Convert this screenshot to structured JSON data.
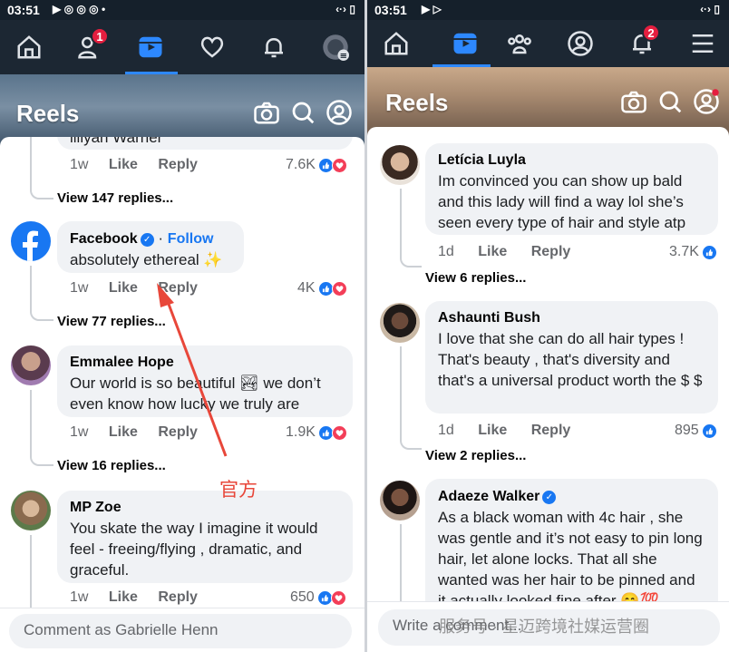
{
  "left": {
    "status": {
      "time": "03:51"
    },
    "nav": {
      "profile_badge": "1"
    },
    "header": {
      "title": "Reels"
    },
    "comments": [
      {
        "name": "",
        "text": "llilyah Warner",
        "age": "1w",
        "like": "Like",
        "reply": "Reply",
        "count": "7.6K",
        "replies": "View 147 replies..."
      },
      {
        "name": "Facebook",
        "follow": "Follow",
        "text": "absolutely ethereal ✨",
        "age": "1w",
        "like": "Like",
        "reply": "Reply",
        "count": "4K",
        "replies": "View 77 replies..."
      },
      {
        "name": "Emmalee Hope",
        "text": "Our world is so beautiful 🏞 we don’t even know how lucky we truly are",
        "age": "1w",
        "like": "Like",
        "reply": "Reply",
        "count": "1.9K",
        "replies": "View 16 replies..."
      },
      {
        "name": "MP Zoe",
        "text": "You skate the way I imagine it would feel - freeing/flying , dramatic, and graceful.",
        "age": "1w",
        "like": "Like",
        "reply": "Reply",
        "count": "650"
      }
    ],
    "comment_placeholder": "Comment as Gabrielle Henn",
    "annotation": "官方"
  },
  "right": {
    "status": {
      "time": "03:51"
    },
    "nav": {
      "notifications_badge": "2"
    },
    "header": {
      "title": "Reels"
    },
    "comments": [
      {
        "name": "Letícia Luyla",
        "text": "Im convinced you can show up bald and this lady will find a way lol she’s seen every type of hair and style atp",
        "age": "1d",
        "like": "Like",
        "reply": "Reply",
        "count": "3.7K",
        "replies": "View 6 replies..."
      },
      {
        "name": "Ashaunti Bush",
        "text": "I love that she can do all hair types ! That's beauty , that's diversity and that's a universal product worth the $ $",
        "age": "1d",
        "like": "Like",
        "reply": "Reply",
        "count": "895",
        "replies": "View 2 replies..."
      },
      {
        "name": "Adaeze Walker",
        "text": "As a black woman with 4c hair , she was gentle and it’s not easy to pin long hair, let alone locks. That all she wanted was her hair to be pinned and it actually looked fine after 😊💯"
      }
    ],
    "comment_placeholder": "Write a comment...",
    "watermark": "服务号 · 星迈跨境社媒运营圈"
  },
  "colors": {
    "accent": "#1877f2",
    "badge": "#e41e3f",
    "arrow": "#e8473a",
    "navbar": "#1c2733"
  }
}
